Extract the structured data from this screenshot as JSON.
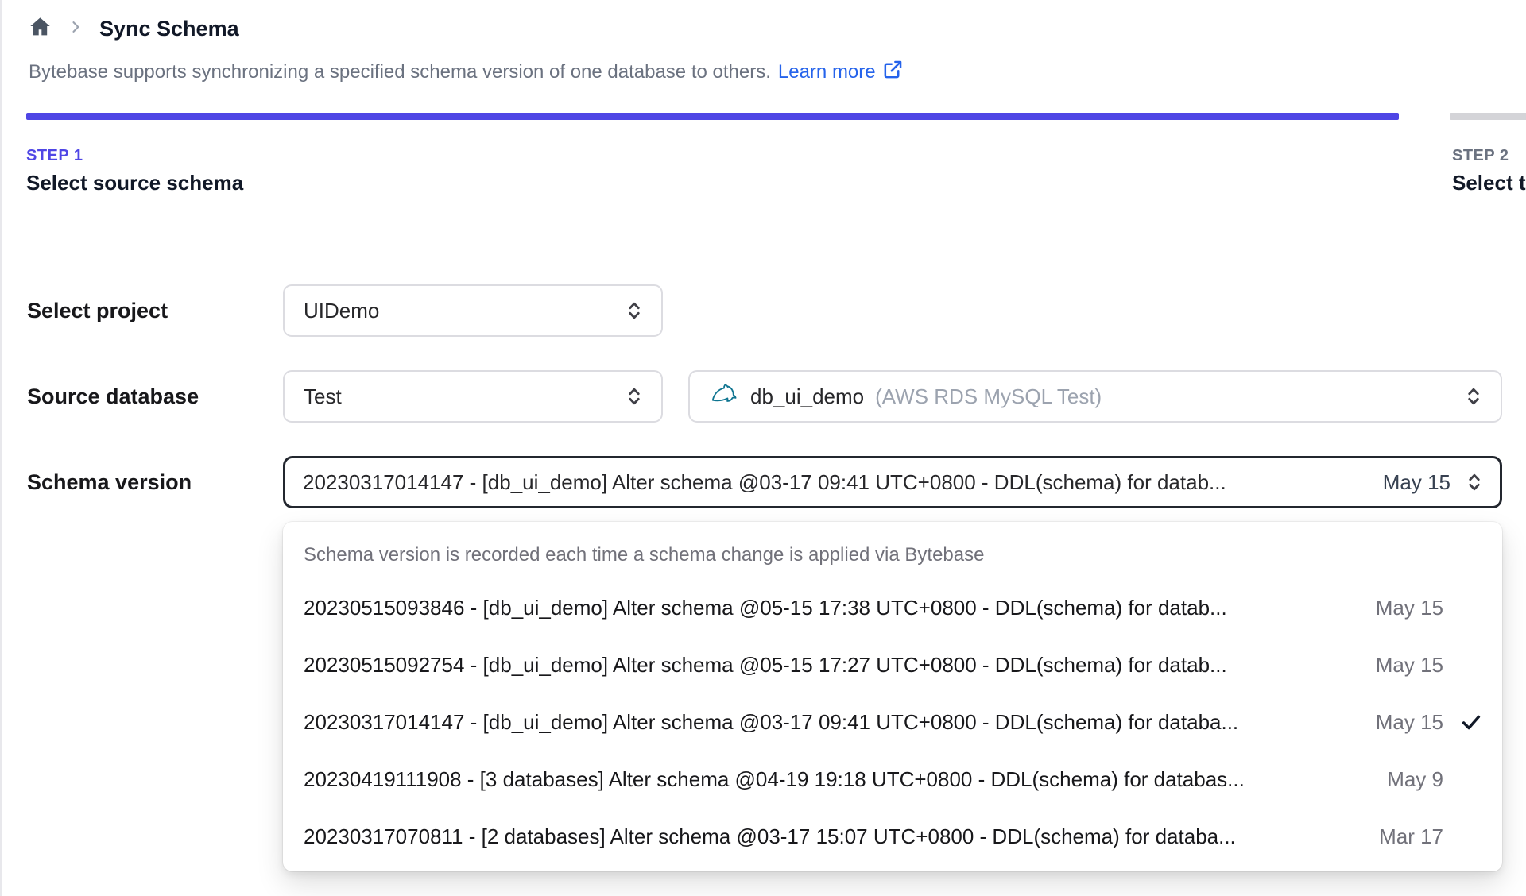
{
  "breadcrumb": {
    "page_title": "Sync Schema"
  },
  "description": {
    "text": "Bytebase supports synchronizing a specified schema version of one database to others.",
    "link_label": "Learn more"
  },
  "steps": [
    {
      "label": "STEP 1",
      "title": "Select source schema",
      "active": true
    },
    {
      "label": "STEP 2",
      "title": "Select t",
      "active": false
    }
  ],
  "form": {
    "project": {
      "label": "Select project",
      "value": "UIDemo"
    },
    "source_database": {
      "label": "Source database",
      "environment_value": "Test",
      "database_name": "db_ui_demo",
      "database_detail": "(AWS RDS MySQL Test)"
    },
    "schema_version": {
      "label": "Schema version",
      "value": "20230317014147 - [db_ui_demo] Alter schema @03-17 09:41 UTC+0800 - DDL(schema) for datab...",
      "date": "May 15"
    }
  },
  "dropdown": {
    "helper": "Schema version is recorded each time a schema change is applied via Bytebase",
    "options": [
      {
        "text": "20230515093846 - [db_ui_demo] Alter schema @05-15 17:38 UTC+0800 - DDL(schema) for datab...",
        "date": "May 15",
        "selected": false
      },
      {
        "text": "20230515092754 - [db_ui_demo] Alter schema @05-15 17:27 UTC+0800 - DDL(schema) for datab...",
        "date": "May 15",
        "selected": false
      },
      {
        "text": "20230317014147 - [db_ui_demo] Alter schema @03-17 09:41 UTC+0800 - DDL(schema) for databa...",
        "date": "May 15",
        "selected": true
      },
      {
        "text": "20230419111908 - [3 databases] Alter schema @04-19 19:18 UTC+0800 - DDL(schema) for databas...",
        "date": "May 9",
        "selected": false
      },
      {
        "text": "20230317070811 - [2 databases] Alter schema @03-17 15:07 UTC+0800 - DDL(schema) for databa...",
        "date": "Mar 17",
        "selected": false
      }
    ]
  },
  "colors": {
    "accent": "#4f46e5",
    "link": "#2563eb",
    "inactive_bar": "#d4d4d8",
    "mysql_icon": "#0e7490"
  }
}
